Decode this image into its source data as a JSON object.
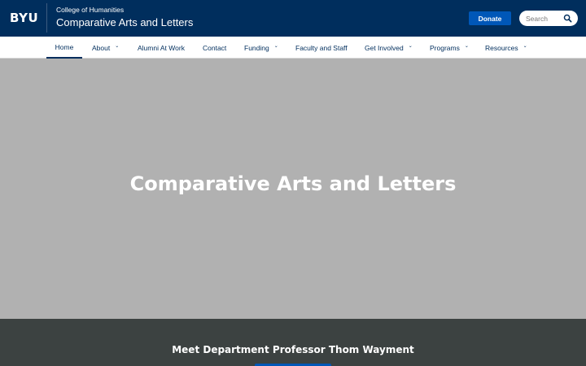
{
  "header": {
    "logo": "BYU",
    "college": "College of Humanities",
    "site_title": "Comparative Arts and Letters",
    "donate_label": "Donate",
    "search_placeholder": "Search"
  },
  "nav": {
    "items": [
      {
        "label": "Home",
        "active": true
      },
      {
        "label": "About",
        "dropdown": true
      },
      {
        "label": "Alumni At Work"
      },
      {
        "label": "Contact"
      },
      {
        "label": "Funding",
        "dropdown": true
      },
      {
        "label": "Faculty and Staff"
      },
      {
        "label": "Get Involved",
        "dropdown": true
      },
      {
        "label": "Programs",
        "dropdown": true
      },
      {
        "label": "Resources",
        "dropdown": true
      }
    ]
  },
  "hero": {
    "title": "Comparative Arts and Letters"
  },
  "feature": {
    "title": "Meet Department Professor Thom Wayment"
  },
  "icons": {
    "search": "search-icon",
    "dropdown": "chevron-down-icon"
  },
  "colors": {
    "header_bg": "#002e5d",
    "accent": "#0057b8",
    "hero_bg": "#b1b1b1",
    "feature_bg": "#3c4241"
  }
}
